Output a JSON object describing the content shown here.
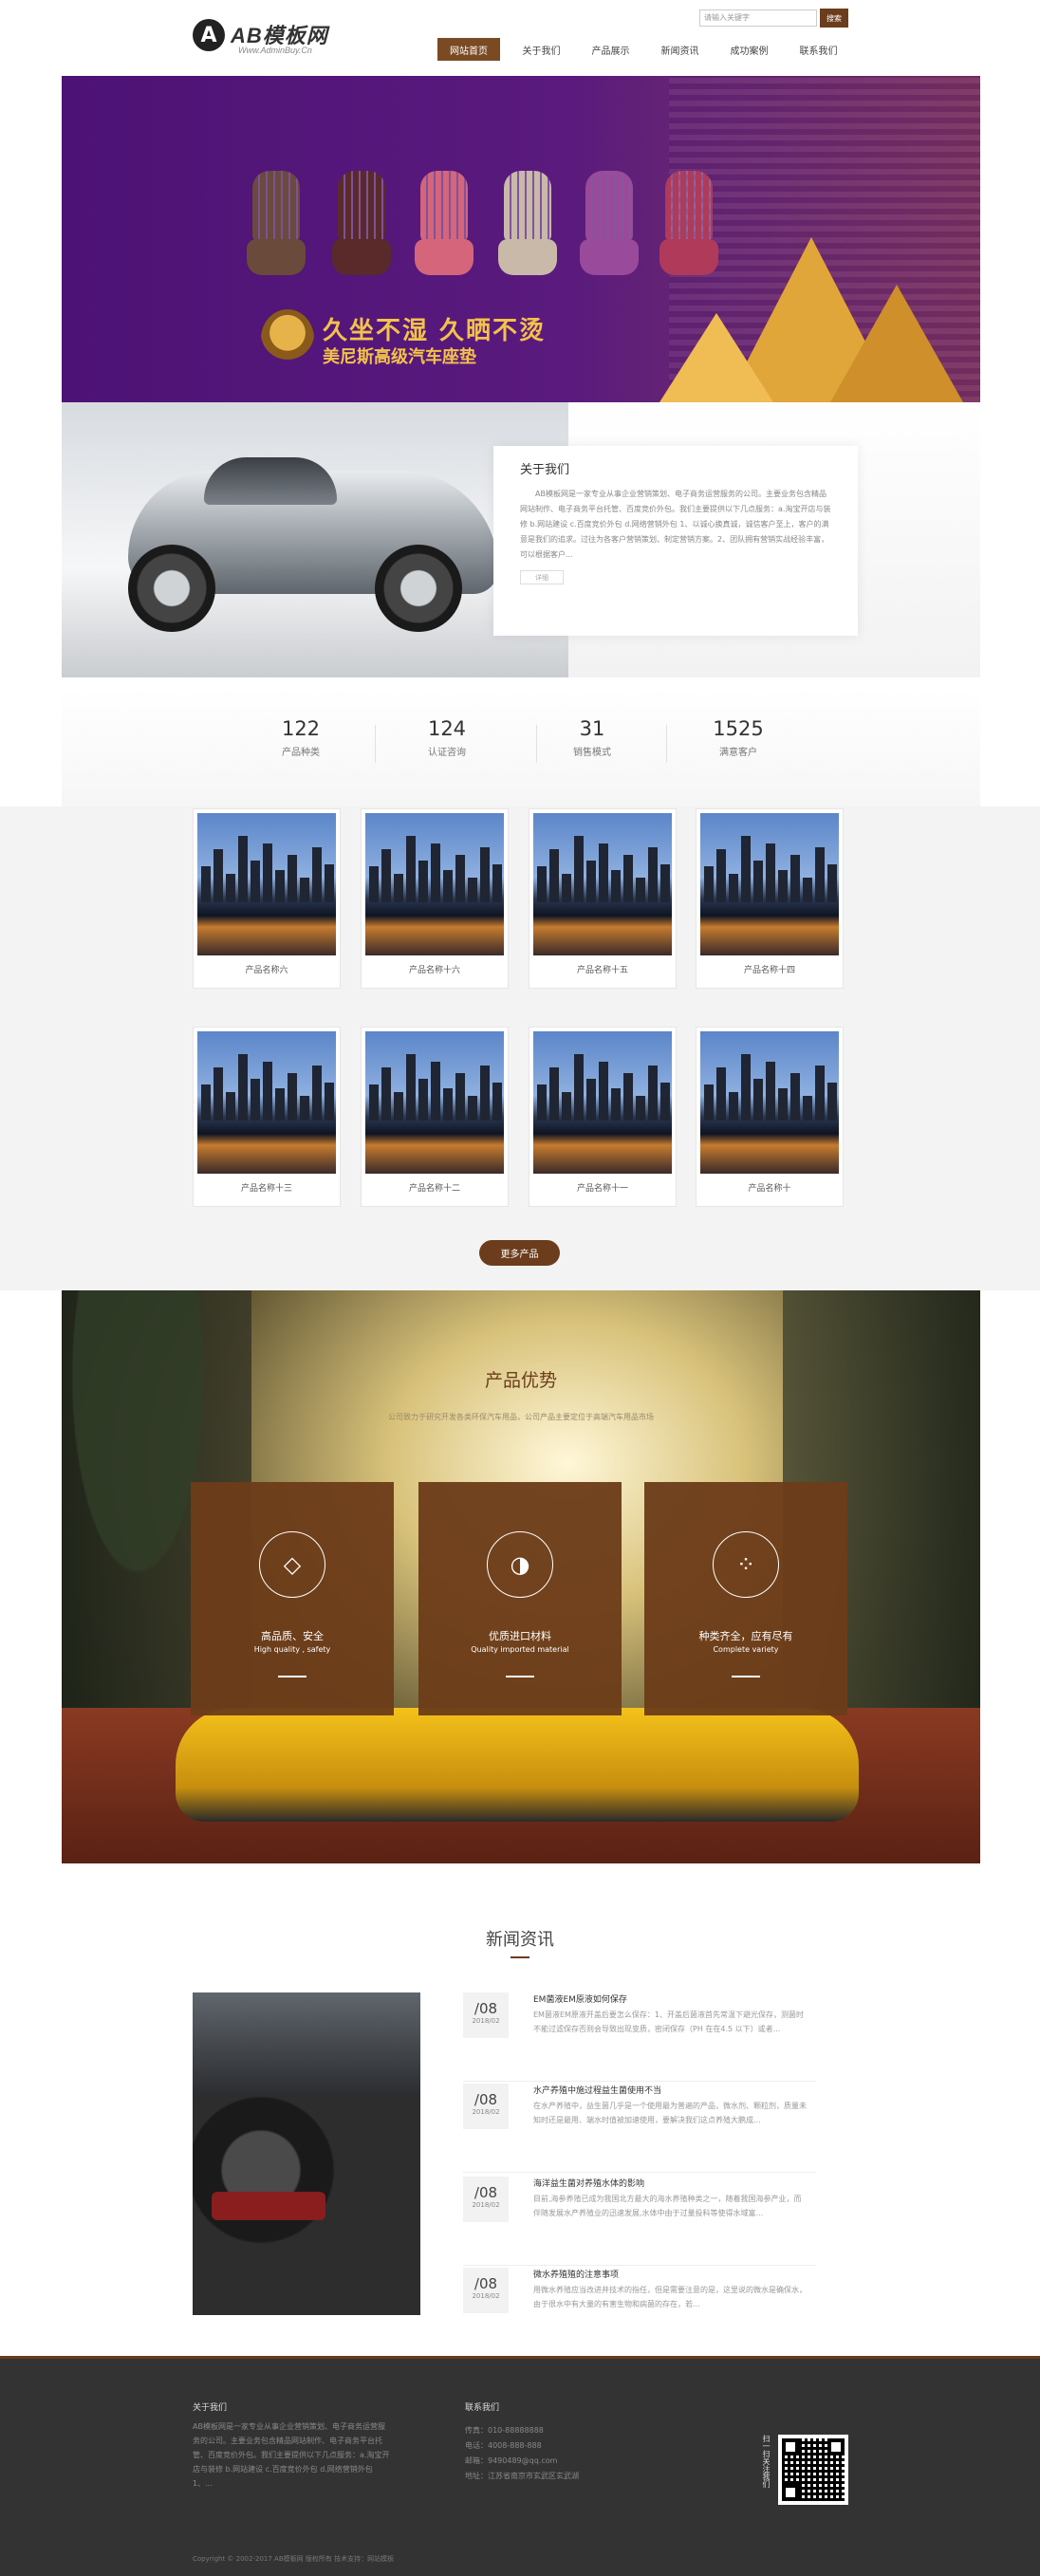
{
  "header": {
    "logo_mark": "A",
    "logo_text": "AB模板网",
    "logo_sub": "Www.AdminBuy.Cn",
    "search_placeholder": "请输入关键字",
    "search_button": "搜索",
    "nav": [
      "网站首页",
      "关于我们",
      "产品展示",
      "新闻资讯",
      "成功案例",
      "联系我们"
    ],
    "active_nav": 0
  },
  "banner": {
    "title": "久坐不湿  久晒不烫",
    "subtitle": "美尼斯高级汽车座垫",
    "seat_colors": [
      "#6a4a3a",
      "#5a2a2a",
      "#d4657a",
      "#c9b9a8",
      "#9a4a9a",
      "#b03a5a"
    ]
  },
  "about": {
    "title": "关于我们",
    "text": "AB模板网是一家专业从事企业营销策划、电子商务运营服务的公司。主要业务包含精品网站制作、电子商务平台托管、百度竞价外包。我们主要提供以下几点服务：a.淘宝开店与装修 b.网站建设 c.百度竞价外包 d.网络营销外包 1、以诚心换真诚，诚信客户至上，客户的满意是我们的追求。过往为各客户营销策划、制定营销方案。2、团队拥有营销实战经验丰富，可以根据客户...",
    "more": "详细"
  },
  "stats": [
    {
      "num": "122",
      "label": "产品种类"
    },
    {
      "num": "124",
      "label": "认证咨询"
    },
    {
      "num": "31",
      "label": "销售模式"
    },
    {
      "num": "1525",
      "label": "满意客户"
    }
  ],
  "products": {
    "items": [
      "产品名称六",
      "产品名称十六",
      "产品名称十五",
      "产品名称十四",
      "产品名称十三",
      "产品名称十二",
      "产品名称十一",
      "产品名称十"
    ],
    "more_button": "更多产品"
  },
  "advantages": {
    "title": "产品优势",
    "subtitle": "公司致力于研究开发各类环保汽车用品，公司产品主要定位于高端汽车用品市场",
    "cards": [
      {
        "icon": "diamond-icon",
        "glyph": "◇",
        "title": "高品质、安全",
        "en": "High quality , safety"
      },
      {
        "icon": "globe-icon",
        "glyph": "◑",
        "title": "优质进口材料",
        "en": "Quality imported material"
      },
      {
        "icon": "variety-icon",
        "glyph": "⁘",
        "title": "种类齐全，应有尽有",
        "en": "Complete variety"
      }
    ]
  },
  "news": {
    "title": "新闻资讯",
    "items": [
      {
        "day": "/08",
        "ym": "2018/02",
        "title": "EM菌液EM原液如何保存",
        "desc": "EM菌液EM原液开盖后要怎么保存：1、开盖后菌液首先常温下避光保存，测菌时不能过滤保存否则会导致出现变质，密闭保存（PH 在在4.5 以下）或者..."
      },
      {
        "day": "/08",
        "ym": "2018/02",
        "title": "水产养殖中施过程益生菌使用不当",
        "desc": "在水产养殖中，益生菌几乎是一个使用最为普遍的产品，微水剂、颗粒剂，质量未知时还是最用、端水时值被加速使用，要解决我们这点养殖大鹏成..."
      },
      {
        "day": "/08",
        "ym": "2018/02",
        "title": "海洋益生菌对养殖水体的影响",
        "desc": "目前,海参养殖已成为我国北方最大的海水养殖种类之一，随着我国海参产业，而伴随发展水产养殖业的迅速发展,水体中由于过量投料等使得水域富..."
      },
      {
        "day": "/08",
        "ym": "2018/02",
        "title": "微水养殖殖的注意事项",
        "desc": "用微水养殖应当改进并技术的指任，但是需要注意的是，这里说的微水是确保水，由于很水中有大量的有害生物和病菌的存在，若..."
      }
    ]
  },
  "footer": {
    "about_title": "关于我们",
    "about_text": "AB模板网是一家专业从事企业营销策划、电子商务运营服务的公司。主要业务包含精品网站制作、电子商务平台托管、百度竞价外包。我们主要提供以下几点服务：a.淘宝开店与装修 b.网站建设 c.百度竞价外包 d.网络营销外包 1、...",
    "contact_title": "联系我们",
    "contact": [
      "传真：010-88888888",
      "电话：4008-888-888",
      "邮箱：9490489@qq.com",
      "地址：江苏省南京市玄武区玄武湖"
    ],
    "qr_label": "扫一扫关注我们",
    "copyright": "Copyright © 2002-2017 AB模板网 版权所有   技术支持：网站模板"
  }
}
